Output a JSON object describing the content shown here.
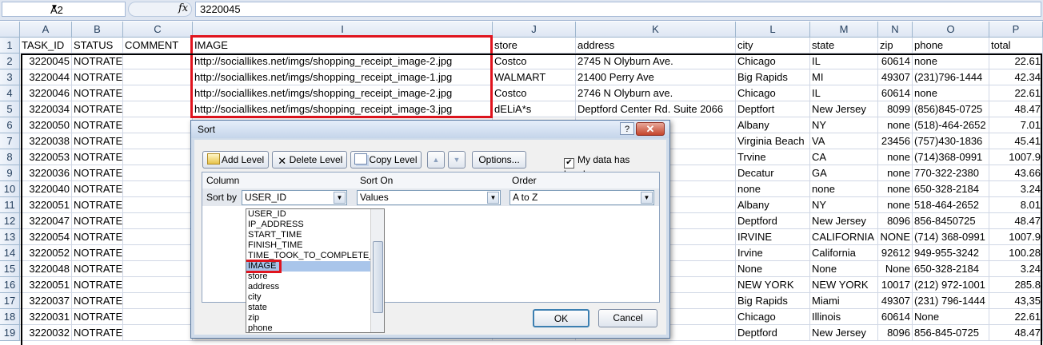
{
  "formula_bar": {
    "name_box": "A2",
    "fx": "fx",
    "value": "3220045"
  },
  "columns": [
    {
      "letter": "A",
      "header": "TASK_ID"
    },
    {
      "letter": "B",
      "header": "STATUS"
    },
    {
      "letter": "C",
      "header": "COMMENT"
    },
    {
      "letter": "I",
      "header": "IMAGE"
    },
    {
      "letter": "J",
      "header": "store"
    },
    {
      "letter": "K",
      "header": "address"
    },
    {
      "letter": "L",
      "header": "city"
    },
    {
      "letter": "M",
      "header": "state"
    },
    {
      "letter": "N",
      "header": "zip"
    },
    {
      "letter": "O",
      "header": "phone"
    },
    {
      "letter": "P",
      "header": "total"
    }
  ],
  "rows": [
    {
      "n": "1"
    },
    {
      "n": "2",
      "task": "3220045",
      "status": "NOTRATED",
      "image": "http://sociallikes.net/imgs/shopping_receipt_image-2.jpg",
      "store": "Costco",
      "address": "2745 N Olyburn Ave.",
      "city": "Chicago",
      "state": "IL",
      "zip": "60614",
      "phone": "none",
      "total": "22.61"
    },
    {
      "n": "3",
      "task": "3220044",
      "status": "NOTRATED",
      "image": "http://sociallikes.net/imgs/shopping_receipt_image-1.jpg",
      "store": "WALMART",
      "address": "21400 Perry Ave",
      "city": "Big Rapids",
      "state": "MI",
      "zip": "49307",
      "phone": "(231)796-1444",
      "total": "42.34"
    },
    {
      "n": "4",
      "task": "3220046",
      "status": "NOTRATED",
      "image": "http://sociallikes.net/imgs/shopping_receipt_image-2.jpg",
      "store": "Costco",
      "address": "2746 N Olyburn ave.",
      "city": "Chicago",
      "state": "IL",
      "zip": "60614",
      "phone": "none",
      "total": "22.61"
    },
    {
      "n": "5",
      "task": "3220034",
      "status": "NOTRATED",
      "image": "http://sociallikes.net/imgs/shopping_receipt_image-3.jpg",
      "store": "dELiA*s",
      "address": " Deptford Center Rd. Suite 2066",
      "city": "Deptfort",
      "state": "New Jersey",
      "zip": "8099",
      "phone": "(856)845-0725",
      "total": "48.47"
    },
    {
      "n": "6",
      "task": "3220050",
      "status": "NOTRATED",
      "image": "",
      "store": "",
      "address": "",
      "city": "Albany",
      "state": "NY",
      "zip": "none",
      "phone": "(518)-464-2652",
      "total": "7.01"
    },
    {
      "n": "7",
      "task": "3220038",
      "status": "NOTRATED",
      "image": "",
      "store": "",
      "address": "",
      "city": "Virginia Beach",
      "state": "VA",
      "zip": "23456",
      "phone": "(757)430-1836",
      "total": "45.41"
    },
    {
      "n": "8",
      "task": "3220053",
      "status": "NOTRATED",
      "image": "",
      "store": "",
      "address": "",
      "city": "Trvine",
      "state": "CA",
      "zip": "none",
      "phone": "(714)368-0991",
      "total": "1007.9"
    },
    {
      "n": "9",
      "task": "3220036",
      "status": "NOTRATED",
      "image": "",
      "store": "",
      "address": ".",
      "city": "Decatur",
      "state": "GA",
      "zip": "none",
      "phone": "770-322-2380",
      "total": "43.66"
    },
    {
      "n": "10",
      "task": "3220040",
      "status": "NOTRATED",
      "image": "",
      "store": "",
      "address": "",
      "city": "none",
      "state": "none",
      "zip": "none",
      "phone": "650-328-2184",
      "total": "3.24"
    },
    {
      "n": "11",
      "task": "3220051",
      "status": "NOTRATED",
      "image": "",
      "store": "",
      "address": "",
      "city": "Albany",
      "state": "NY",
      "zip": "none",
      "phone": "518-464-2652",
      "total": "8.01"
    },
    {
      "n": "12",
      "task": "3220047",
      "status": "NOTRATED",
      "image": "",
      "store": "",
      "address": "ter Rd.",
      "city": "Deptford",
      "state": "New Jersey",
      "zip": "8096",
      "phone": "856-8450725",
      "total": "48.47"
    },
    {
      "n": "13",
      "task": "3220054",
      "status": "NOTRATED",
      "image": "",
      "store": "",
      "address": "",
      "city": "IRVINE",
      "state": "CALIFORNIA",
      "zip": "NONE",
      "phone": "(714) 368-0991",
      "total": "1007.9"
    },
    {
      "n": "14",
      "task": "3220052",
      "status": "NOTRATED",
      "image": "",
      "store": "",
      "address": "",
      "city": "Irvine",
      "state": "California",
      "zip": "92612",
      "phone": "949-955-3242",
      "total": "100.28"
    },
    {
      "n": "15",
      "task": "3220048",
      "status": "NOTRATED",
      "image": "",
      "store": "",
      "address": "",
      "city": "None",
      "state": "None",
      "zip": "None",
      "phone": "650-328-2184",
      "total": "3.24"
    },
    {
      "n": "16",
      "task": "3220051",
      "status": "NOTRATED",
      "image": "",
      "store": "",
      "address": "EET",
      "city": "NEW YORK",
      "state": "NEW YORK",
      "zip": "10017",
      "phone": "(212) 972-1001",
      "total": "285.8"
    },
    {
      "n": "17",
      "task": "3220037",
      "status": "NOTRATED",
      "image": "",
      "store": "",
      "address": "",
      "city": "Big Rapids",
      "state": "Miami",
      "zip": "49307",
      "phone": "(231) 796-1444",
      "total": "43,35"
    },
    {
      "n": "18",
      "task": "3220031",
      "status": "NOTRATED",
      "image": "",
      "store": "",
      "address": "",
      "city": "Chicago",
      "state": "Illinois",
      "zip": "60614",
      "phone": "None",
      "total": "22.61"
    },
    {
      "n": "19",
      "task": "3220032",
      "status": "NOTRATED",
      "image": "",
      "store": "",
      "address": "ter Rd.",
      "city": "Deptford",
      "state": "New Jersey",
      "zip": "8096",
      "phone": "856-845-0725",
      "total": "48.47"
    }
  ],
  "dialog": {
    "title": "Sort",
    "help": "?",
    "close": "✕",
    "add_level": "Add Level",
    "delete_level": "Delete Level",
    "copy_level": "Copy Level",
    "up": "▲",
    "down": "▼",
    "options": "Options...",
    "my_data_headers": "My data has headers",
    "headers_checked": true,
    "col_column": "Column",
    "col_sort_on": "Sort On",
    "col_order": "Order",
    "sort_by": "Sort by",
    "sort_by_value": "USER_ID",
    "sort_on_value": "Values",
    "order_value": "A to Z",
    "dropdown_options": [
      "USER_ID",
      "IP_ADDRESS",
      "START_TIME",
      "FINISH_TIME",
      "TIME_TOOK_TO_COMPLETE_TA",
      "IMAGE",
      "store",
      "address",
      "city",
      "state",
      "zip",
      "phone"
    ],
    "highlighted_option": "IMAGE",
    "ok": "OK",
    "cancel": "Cancel"
  },
  "colors": {
    "highlight_red": "#e0141e",
    "header_blue": "#dde6f3",
    "dialog_bg": "#cfdbea"
  }
}
